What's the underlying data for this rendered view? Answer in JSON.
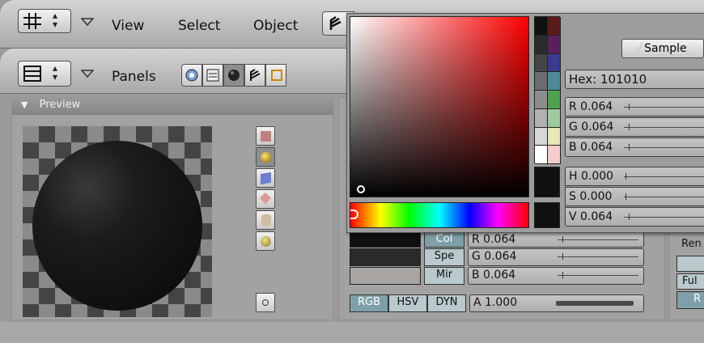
{
  "header1": {
    "menus": [
      "View",
      "Select",
      "Object"
    ]
  },
  "header2": {
    "panels_label": "Panels"
  },
  "preview": {
    "title": "Preview"
  },
  "material": {
    "color_tabs": [
      "Col",
      "Spe",
      "Mir"
    ],
    "rgb_fields": [
      {
        "label": "R 0.064",
        "value": 0.064
      },
      {
        "label": "G 0.064",
        "value": 0.064
      },
      {
        "label": "B 0.064",
        "value": 0.064
      }
    ],
    "mode_tabs": [
      "RGB",
      "HSV",
      "DYN"
    ],
    "alpha_field": {
      "label": "A 1.000",
      "value": 1.0
    },
    "swatch_colors": [
      "#101010",
      "#2a2a2a",
      "#a8a4a2"
    ]
  },
  "picker": {
    "sample_label": "Sample",
    "hex_field": "Hex: 101010",
    "rgb": [
      {
        "label": "R 0.064",
        "value": 0.064
      },
      {
        "label": "G 0.064",
        "value": 0.064
      },
      {
        "label": "B 0.064",
        "value": 0.064
      }
    ],
    "hsv": [
      {
        "label": "H 0.000",
        "value": 0.0
      },
      {
        "label": "S 0.000",
        "value": 0.0
      },
      {
        "label": "V 0.064",
        "value": 0.064
      }
    ],
    "hue_color": "#ff0000",
    "current_color": "#101010",
    "palette": [
      [
        "#101010",
        "#5b1b1b"
      ],
      [
        "#2b2b2b",
        "#5b1f5b"
      ],
      [
        "#454545",
        "#3a3a8e"
      ],
      [
        "#6c6c6c",
        "#4b8c98"
      ],
      [
        "#8d8d8d",
        "#4fa04f"
      ],
      [
        "#b2b2b2",
        "#9fc99f"
      ],
      [
        "#d6d6d6",
        "#e9e6b7"
      ],
      [
        "#ffffff",
        "#f3cccc"
      ]
    ]
  },
  "right_panel": {
    "label_fragment": "Ren",
    "label_full": "Ful",
    "label_r": "R"
  }
}
